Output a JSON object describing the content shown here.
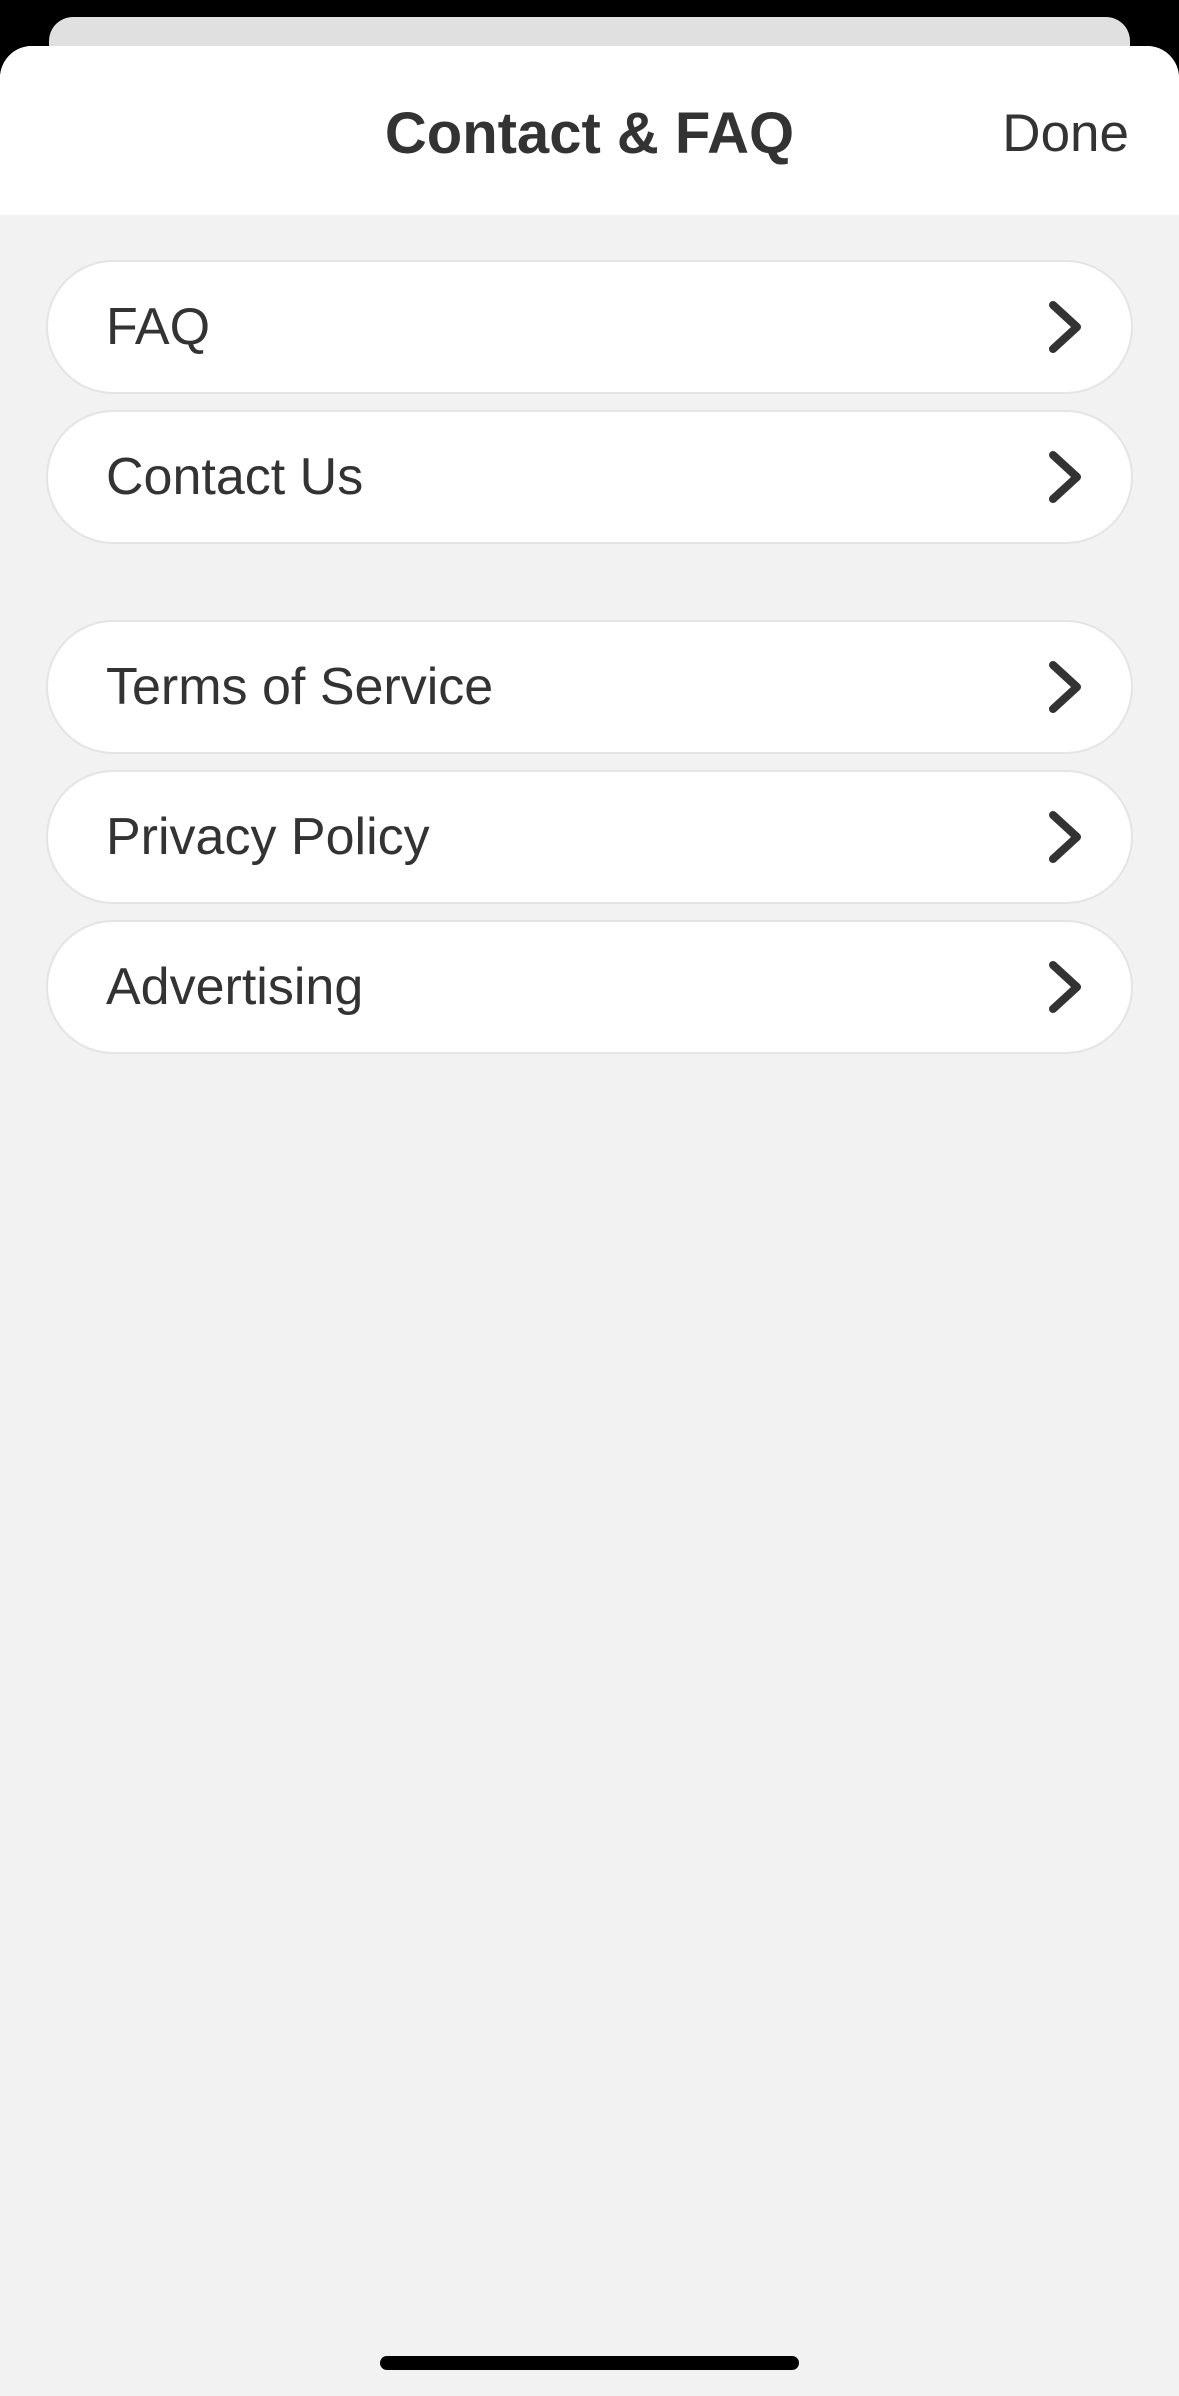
{
  "header": {
    "title": "Contact & FAQ",
    "done_label": "Done"
  },
  "groups": [
    {
      "items": [
        {
          "label": "FAQ",
          "icon": "chevron-right-icon"
        },
        {
          "label": "Contact Us",
          "icon": "chevron-right-icon"
        }
      ]
    },
    {
      "items": [
        {
          "label": "Terms of Service",
          "icon": "chevron-right-icon"
        },
        {
          "label": "Privacy Policy",
          "icon": "chevron-right-icon"
        },
        {
          "label": "Advertising",
          "icon": "chevron-right-icon"
        }
      ]
    }
  ],
  "colors": {
    "background": "#f2f2f2",
    "card": "#ffffff",
    "text": "#333333",
    "border": "#e4e4e4"
  }
}
